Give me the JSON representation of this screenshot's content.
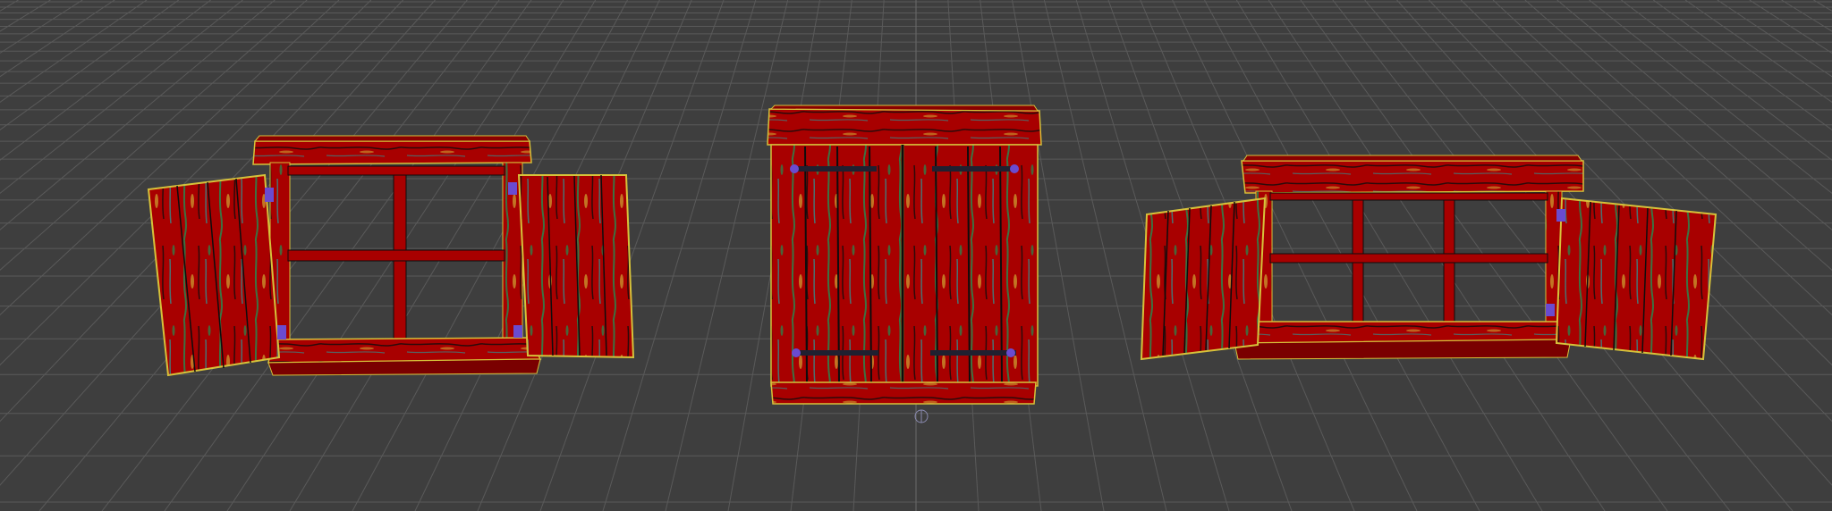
{
  "viewport": {
    "background": "#3e3e3e",
    "grid_color": "#5a5a5a",
    "grid_major_color": "#6a6a6a"
  },
  "colors": {
    "wood_red": "#a80000",
    "wood_red_dark": "#7a0000",
    "outline_yellow": "#d6c23a",
    "streak_green": "#1f8f52",
    "streak_teal": "#22a0a0",
    "shadow_black": "#101010",
    "hinge_purple": "#6a4bd0",
    "hinge_dark": "#202030"
  },
  "objects": [
    {
      "name": "left-window-with-open-shutters",
      "icon": "window-icon"
    },
    {
      "name": "center-closed-double-shutter",
      "icon": "door-icon"
    },
    {
      "name": "right-wide-window-with-open-shutters",
      "icon": "window-icon"
    }
  ]
}
